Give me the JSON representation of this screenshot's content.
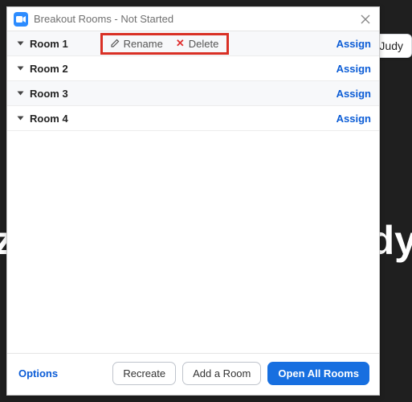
{
  "background": {
    "text_left_fragment": "z",
    "text_right_fragment": "udy"
  },
  "dialog": {
    "title": "Breakout Rooms - Not Started",
    "close_icon": "close-icon",
    "rooms": [
      {
        "name": "Room 1",
        "assign_label": "Assign",
        "show_actions": true
      },
      {
        "name": "Room 2",
        "assign_label": "Assign",
        "show_actions": false
      },
      {
        "name": "Room 3",
        "assign_label": "Assign",
        "show_actions": false
      },
      {
        "name": "Room 4",
        "assign_label": "Assign",
        "show_actions": false
      }
    ],
    "row_actions": {
      "rename_label": "Rename",
      "delete_label": "Delete"
    },
    "footer": {
      "options_label": "Options",
      "recreate_label": "Recreate",
      "add_room_label": "Add a Room",
      "open_all_label": "Open All Rooms"
    }
  },
  "participant_popout": {
    "name": "Judy",
    "checked": false
  }
}
